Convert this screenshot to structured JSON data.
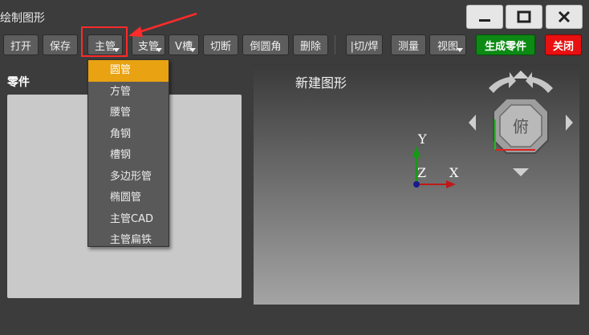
{
  "window": {
    "title": "绘制图形"
  },
  "toolbar": {
    "open": "打开",
    "save": "保存",
    "main_pipe": "主管",
    "branch_pipe": "支管",
    "v_groove": "V槽",
    "cut_off": "切断",
    "chamfer": "倒圆角",
    "delete": "删除",
    "cut_weld": "|切/焊",
    "measure": "测量",
    "view": "视图",
    "generate_part": "生成零件",
    "close": "关闭"
  },
  "dropdown": {
    "items": [
      "圆管",
      "方管",
      "腰管",
      "角钢",
      "槽钢",
      "多边形管",
      "椭圆管",
      "主管CAD",
      "主管扁铁"
    ],
    "selected": "圆管"
  },
  "parts": {
    "label": "零件"
  },
  "viewport": {
    "title": "新建图形",
    "view_face": "俯",
    "axis_x": "X",
    "axis_y": "Y",
    "axis_z": "Z"
  },
  "colors": {
    "accent_selected": "#e8a212",
    "generate_button": "#0c8a14",
    "close_button": "#e81010",
    "highlight_box": "#ff2a2a",
    "axis_x": "#c01818",
    "axis_y": "#149a14",
    "axis_z": "#1a1a90"
  }
}
